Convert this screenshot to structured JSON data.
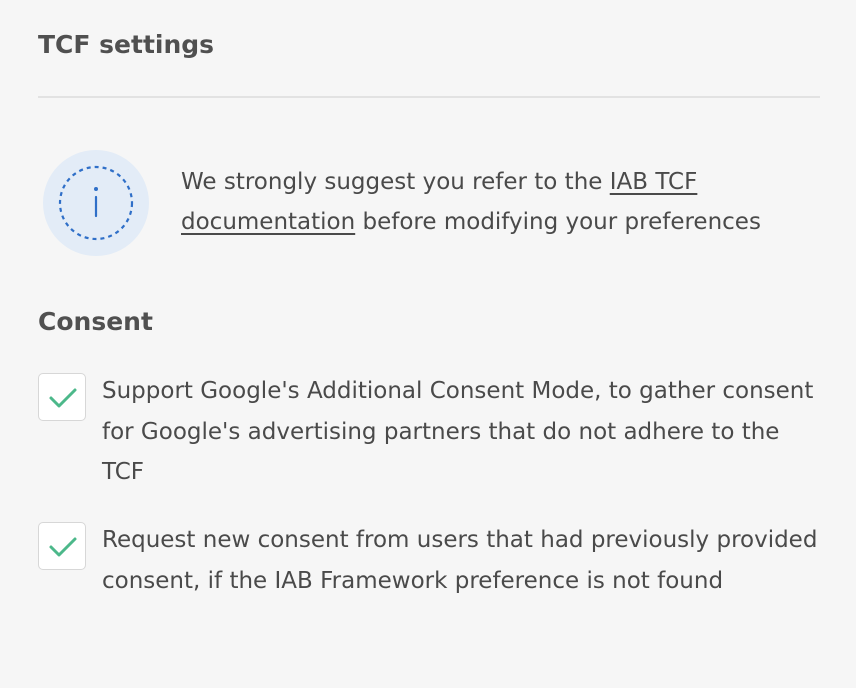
{
  "header": {
    "title": "TCF settings"
  },
  "info": {
    "icon": "info-icon",
    "text_before": "We strongly suggest you refer to the ",
    "link_text": "IAB TCF documentation",
    "text_after": " before modifying your preferences",
    "colors": {
      "badge_bg": "#e3ecf7",
      "icon_stroke": "#2f6fc8"
    }
  },
  "consent": {
    "title": "Consent",
    "options": [
      {
        "label": "Support Google's Additional Consent Mode, to gather consent for Google's advertising partners that do not adhere to the TCF",
        "checked": true,
        "icon": "checkmark-icon"
      },
      {
        "label": "Request new consent from users that had previously provided consent, if the IAB Framework preference is not found",
        "checked": true,
        "icon": "checkmark-icon"
      }
    ],
    "check_color": "#4cb88a"
  }
}
